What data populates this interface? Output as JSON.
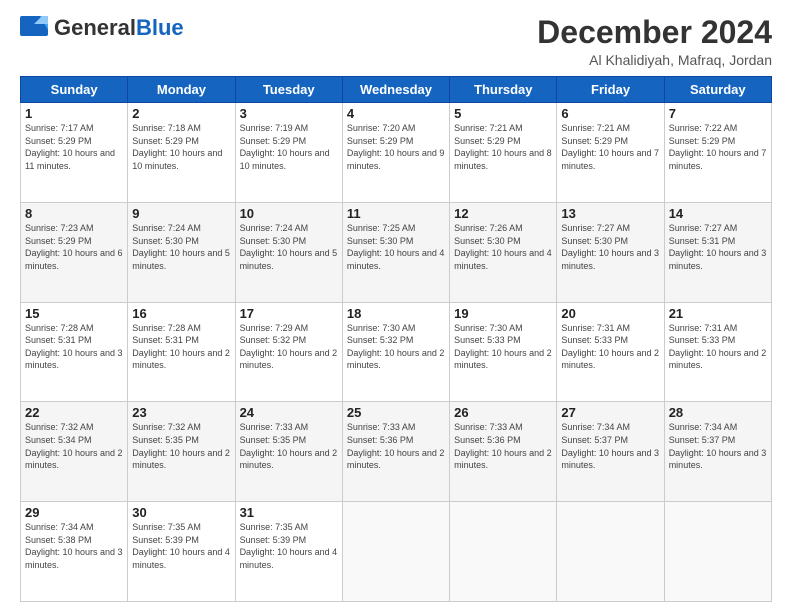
{
  "header": {
    "logo_general": "General",
    "logo_blue": "Blue",
    "month_title": "December 2024",
    "location": "Al Khalidiyah, Mafraq, Jordan"
  },
  "days_of_week": [
    "Sunday",
    "Monday",
    "Tuesday",
    "Wednesday",
    "Thursday",
    "Friday",
    "Saturday"
  ],
  "weeks": [
    [
      {
        "day": "1",
        "sunrise": "Sunrise: 7:17 AM",
        "sunset": "Sunset: 5:29 PM",
        "daylight": "Daylight: 10 hours and 11 minutes."
      },
      {
        "day": "2",
        "sunrise": "Sunrise: 7:18 AM",
        "sunset": "Sunset: 5:29 PM",
        "daylight": "Daylight: 10 hours and 10 minutes."
      },
      {
        "day": "3",
        "sunrise": "Sunrise: 7:19 AM",
        "sunset": "Sunset: 5:29 PM",
        "daylight": "Daylight: 10 hours and 10 minutes."
      },
      {
        "day": "4",
        "sunrise": "Sunrise: 7:20 AM",
        "sunset": "Sunset: 5:29 PM",
        "daylight": "Daylight: 10 hours and 9 minutes."
      },
      {
        "day": "5",
        "sunrise": "Sunrise: 7:21 AM",
        "sunset": "Sunset: 5:29 PM",
        "daylight": "Daylight: 10 hours and 8 minutes."
      },
      {
        "day": "6",
        "sunrise": "Sunrise: 7:21 AM",
        "sunset": "Sunset: 5:29 PM",
        "daylight": "Daylight: 10 hours and 7 minutes."
      },
      {
        "day": "7",
        "sunrise": "Sunrise: 7:22 AM",
        "sunset": "Sunset: 5:29 PM",
        "daylight": "Daylight: 10 hours and 7 minutes."
      }
    ],
    [
      {
        "day": "8",
        "sunrise": "Sunrise: 7:23 AM",
        "sunset": "Sunset: 5:29 PM",
        "daylight": "Daylight: 10 hours and 6 minutes."
      },
      {
        "day": "9",
        "sunrise": "Sunrise: 7:24 AM",
        "sunset": "Sunset: 5:30 PM",
        "daylight": "Daylight: 10 hours and 5 minutes."
      },
      {
        "day": "10",
        "sunrise": "Sunrise: 7:24 AM",
        "sunset": "Sunset: 5:30 PM",
        "daylight": "Daylight: 10 hours and 5 minutes."
      },
      {
        "day": "11",
        "sunrise": "Sunrise: 7:25 AM",
        "sunset": "Sunset: 5:30 PM",
        "daylight": "Daylight: 10 hours and 4 minutes."
      },
      {
        "day": "12",
        "sunrise": "Sunrise: 7:26 AM",
        "sunset": "Sunset: 5:30 PM",
        "daylight": "Daylight: 10 hours and 4 minutes."
      },
      {
        "day": "13",
        "sunrise": "Sunrise: 7:27 AM",
        "sunset": "Sunset: 5:30 PM",
        "daylight": "Daylight: 10 hours and 3 minutes."
      },
      {
        "day": "14",
        "sunrise": "Sunrise: 7:27 AM",
        "sunset": "Sunset: 5:31 PM",
        "daylight": "Daylight: 10 hours and 3 minutes."
      }
    ],
    [
      {
        "day": "15",
        "sunrise": "Sunrise: 7:28 AM",
        "sunset": "Sunset: 5:31 PM",
        "daylight": "Daylight: 10 hours and 3 minutes."
      },
      {
        "day": "16",
        "sunrise": "Sunrise: 7:28 AM",
        "sunset": "Sunset: 5:31 PM",
        "daylight": "Daylight: 10 hours and 2 minutes."
      },
      {
        "day": "17",
        "sunrise": "Sunrise: 7:29 AM",
        "sunset": "Sunset: 5:32 PM",
        "daylight": "Daylight: 10 hours and 2 minutes."
      },
      {
        "day": "18",
        "sunrise": "Sunrise: 7:30 AM",
        "sunset": "Sunset: 5:32 PM",
        "daylight": "Daylight: 10 hours and 2 minutes."
      },
      {
        "day": "19",
        "sunrise": "Sunrise: 7:30 AM",
        "sunset": "Sunset: 5:33 PM",
        "daylight": "Daylight: 10 hours and 2 minutes."
      },
      {
        "day": "20",
        "sunrise": "Sunrise: 7:31 AM",
        "sunset": "Sunset: 5:33 PM",
        "daylight": "Daylight: 10 hours and 2 minutes."
      },
      {
        "day": "21",
        "sunrise": "Sunrise: 7:31 AM",
        "sunset": "Sunset: 5:33 PM",
        "daylight": "Daylight: 10 hours and 2 minutes."
      }
    ],
    [
      {
        "day": "22",
        "sunrise": "Sunrise: 7:32 AM",
        "sunset": "Sunset: 5:34 PM",
        "daylight": "Daylight: 10 hours and 2 minutes."
      },
      {
        "day": "23",
        "sunrise": "Sunrise: 7:32 AM",
        "sunset": "Sunset: 5:35 PM",
        "daylight": "Daylight: 10 hours and 2 minutes."
      },
      {
        "day": "24",
        "sunrise": "Sunrise: 7:33 AM",
        "sunset": "Sunset: 5:35 PM",
        "daylight": "Daylight: 10 hours and 2 minutes."
      },
      {
        "day": "25",
        "sunrise": "Sunrise: 7:33 AM",
        "sunset": "Sunset: 5:36 PM",
        "daylight": "Daylight: 10 hours and 2 minutes."
      },
      {
        "day": "26",
        "sunrise": "Sunrise: 7:33 AM",
        "sunset": "Sunset: 5:36 PM",
        "daylight": "Daylight: 10 hours and 2 minutes."
      },
      {
        "day": "27",
        "sunrise": "Sunrise: 7:34 AM",
        "sunset": "Sunset: 5:37 PM",
        "daylight": "Daylight: 10 hours and 3 minutes."
      },
      {
        "day": "28",
        "sunrise": "Sunrise: 7:34 AM",
        "sunset": "Sunset: 5:37 PM",
        "daylight": "Daylight: 10 hours and 3 minutes."
      }
    ],
    [
      {
        "day": "29",
        "sunrise": "Sunrise: 7:34 AM",
        "sunset": "Sunset: 5:38 PM",
        "daylight": "Daylight: 10 hours and 3 minutes."
      },
      {
        "day": "30",
        "sunrise": "Sunrise: 7:35 AM",
        "sunset": "Sunset: 5:39 PM",
        "daylight": "Daylight: 10 hours and 4 minutes."
      },
      {
        "day": "31",
        "sunrise": "Sunrise: 7:35 AM",
        "sunset": "Sunset: 5:39 PM",
        "daylight": "Daylight: 10 hours and 4 minutes."
      },
      null,
      null,
      null,
      null
    ]
  ]
}
